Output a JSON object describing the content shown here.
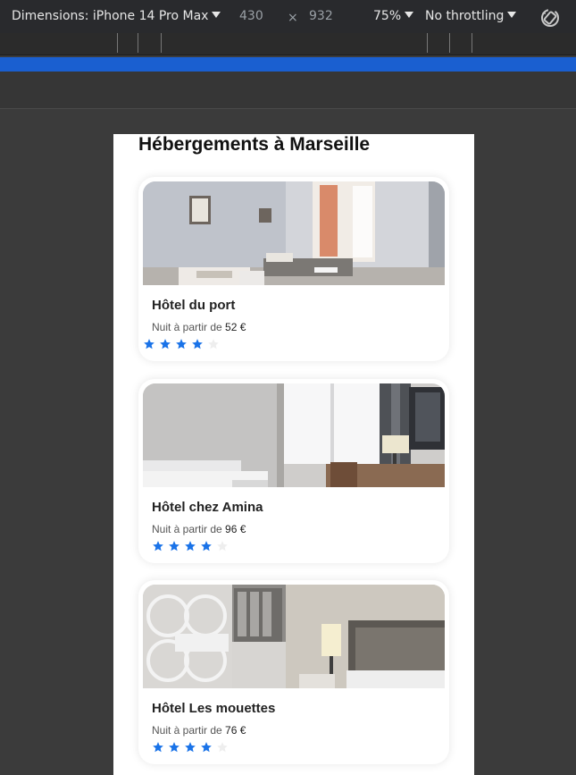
{
  "devtools": {
    "dimensions_label": "Dimensions: iPhone 14 Pro Max",
    "width": "430",
    "times": "×",
    "height": "932",
    "zoom": "75%",
    "throttling": "No throttling"
  },
  "page": {
    "title": "Hébergements à Marseille",
    "hotels": [
      {
        "name": "Hôtel du port",
        "price_prefix": "Nuit à partir de",
        "price": "52 €",
        "rating": 4,
        "max_rating": 5
      },
      {
        "name": "Hôtel chez Amina",
        "price_prefix": "Nuit à partir de",
        "price": "96 €",
        "rating": 4,
        "max_rating": 5
      },
      {
        "name": "Hôtel Les mouettes",
        "price_prefix": "Nuit à partir de",
        "price": "76 €",
        "rating": 4,
        "max_rating": 5
      }
    ]
  },
  "colors": {
    "star_filled": "#1a73e8",
    "star_empty": "#eeeeee",
    "devtools_accent": "#1a5fd0"
  }
}
